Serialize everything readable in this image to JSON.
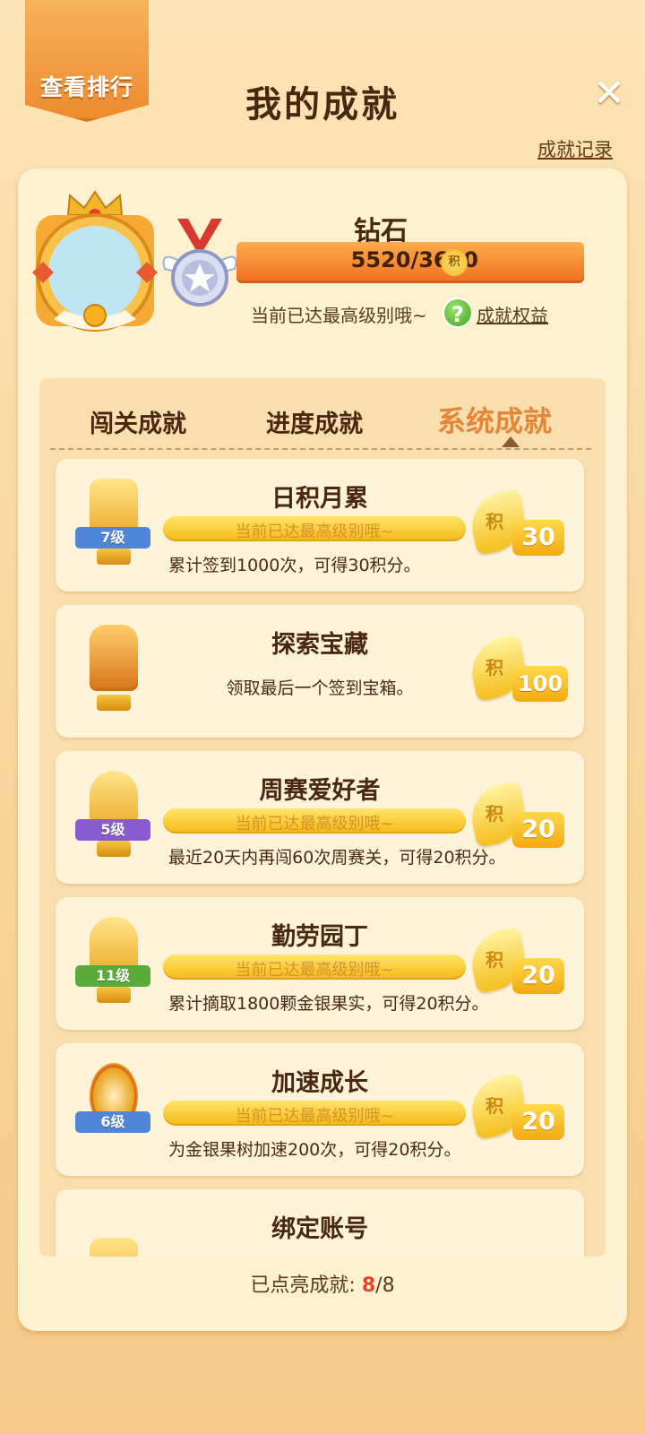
{
  "header": {
    "rank_button": "查看排行",
    "title": "我的成就",
    "close": "✕",
    "record_link": "成就记录"
  },
  "profile": {
    "rank_name": "钻石",
    "progress_text": "5520/3600",
    "progress_fraction": 1,
    "coin_label": "积",
    "max_hint": "当前已达最高级别哦~",
    "help_icon": "?",
    "benefit_link": "成就权益"
  },
  "tabs": [
    {
      "label": "闯关成就"
    },
    {
      "label": "进度成就"
    },
    {
      "label": "系统成就"
    }
  ],
  "active_tab": "系统成就",
  "cards": [
    {
      "title": "日积月累",
      "bar": "当前已达最高级别哦~",
      "desc": "累计签到1000次，可得30积分。",
      "level": "7级",
      "ribbon_color": "#4f86d8",
      "reward_label": "积",
      "reward": "30"
    },
    {
      "title": "探索宝藏",
      "desc": "领取最后一个签到宝箱。",
      "reward_label": "积",
      "reward": "100"
    },
    {
      "title": "周赛爱好者",
      "bar": "当前已达最高级别哦~",
      "desc": "最近20天内再闯60次周赛关，可得20积分。",
      "level": "5级",
      "ribbon_color": "#8a5ad0",
      "reward_label": "积",
      "reward": "20"
    },
    {
      "title": "勤劳园丁",
      "bar": "当前已达最高级别哦~",
      "desc": "累计摘取1800颗金银果实，可得20积分。",
      "level": "11级",
      "ribbon_color": "#5aab3a",
      "reward_label": "积",
      "reward": "20"
    },
    {
      "title": "加速成长",
      "bar": "当前已达最高级别哦~",
      "desc": "为金银果树加速200次，可得20积分。",
      "level": "6级",
      "ribbon_color": "#4f86d8",
      "reward_label": "积",
      "reward": "20"
    },
    {
      "title": "绑定账号"
    }
  ],
  "footer": {
    "label": "已点亮成就:",
    "lit": "8",
    "total": "/8"
  }
}
